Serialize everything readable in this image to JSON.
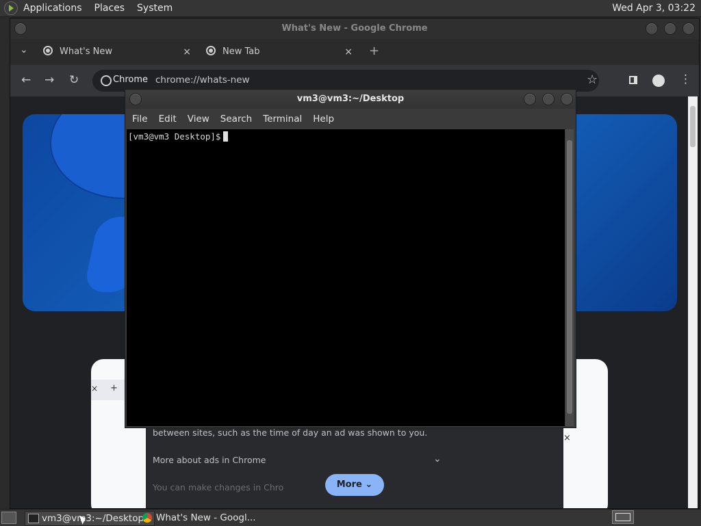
{
  "top_panel": {
    "menus": [
      "Applications",
      "Places",
      "System"
    ],
    "clock": "Wed Apr  3, 03:22"
  },
  "chrome": {
    "window_title": "What's New - Google Chrome",
    "tabs": [
      {
        "label": "What's New",
        "close": "×"
      },
      {
        "label": "New Tab",
        "close": "×"
      }
    ],
    "new_tab": "+",
    "tab_search": "⌄",
    "omnibox": {
      "chip": "Chrome",
      "url": "chrome://whats-new"
    },
    "page": {
      "ads_text": "between sites, such as the time of day an ad was shown to you.",
      "ads_more_about": "More about ads in Chrome",
      "ads_change": "You can make changes in Chro",
      "more_button": "More",
      "inner_tab_close": "×",
      "inner_tab_plus": "+",
      "inner_panel_close": "×"
    }
  },
  "terminal": {
    "title": "vm3@vm3:~/Desktop",
    "menus": [
      "File",
      "Edit",
      "View",
      "Search",
      "Terminal",
      "Help"
    ],
    "prompt": "[vm3@vm3 Desktop]$"
  },
  "taskbar": {
    "items": [
      "vm3@vm3:~/Desktop",
      "What's New - Googl..."
    ]
  }
}
